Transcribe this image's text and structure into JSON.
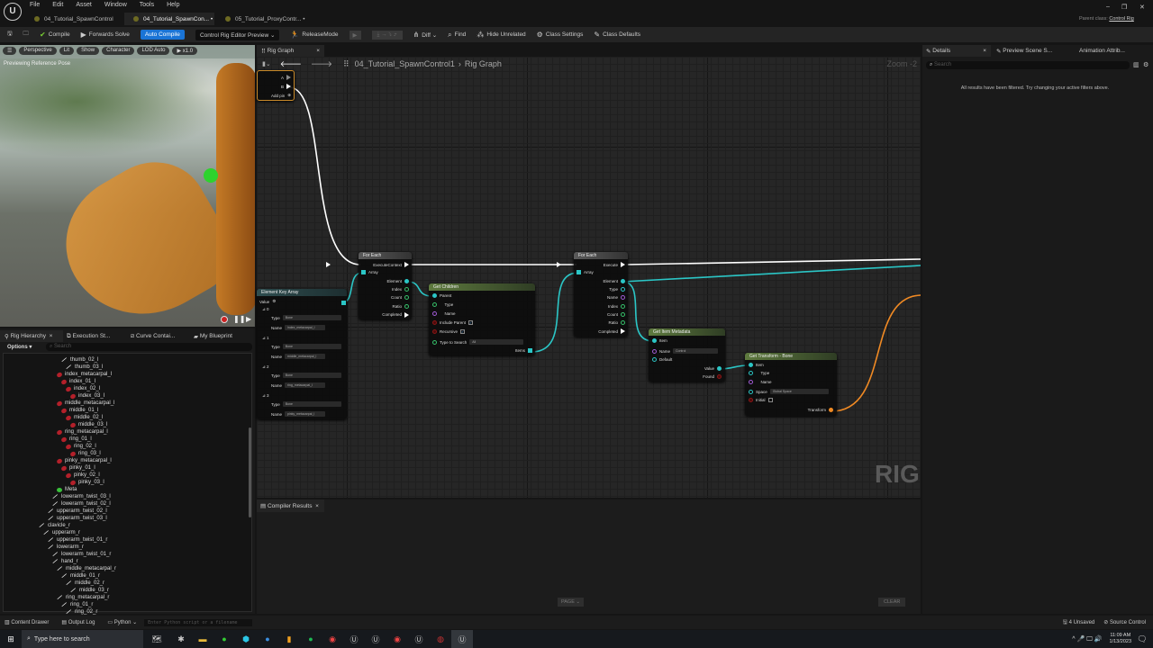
{
  "menu": [
    "File",
    "Edit",
    "Asset",
    "Window",
    "Tools",
    "Help"
  ],
  "doc_tabs": [
    {
      "label": "04_Tutorial_SpawnControl"
    },
    {
      "label": "04_Tutorial_SpawnCon... •",
      "close": "×"
    },
    {
      "label": "05_Tutorial_ProxyContr... •"
    }
  ],
  "window": {
    "parent_class_label": "Parent class:",
    "parent_class": "Control Rig",
    "minimize": "–",
    "restore": "❐",
    "close": "✕"
  },
  "toolbar": {
    "compile": "Compile",
    "forwards_solve": "Forwards Solve",
    "auto_compile": "Auto Compile",
    "preview": "Control Rig Editor Preview ⌄",
    "release_mode": "ReleaseMode",
    "diff": "Diff ⌄",
    "find": "Find",
    "hide_unrelated": "Hide Unrelated",
    "class_settings": "Class Settings",
    "class_defaults": "Class Defaults"
  },
  "viewport": {
    "buttons": [
      "Perspective",
      "Lit",
      "Show",
      "Character",
      "LOD Auto",
      "▶ x1.0"
    ],
    "overlay": "Previewing Reference Pose"
  },
  "left_tabs": {
    "rig_hierarchy": "Rig Hierarchy",
    "execution_stack": "Execution St...",
    "curve_container": "Curve Contai...",
    "my_blueprint": "My Blueprint",
    "options": "Options ▾",
    "search_placeholder": "Search"
  },
  "tree": [
    {
      "label": "thumb_02_l",
      "level": 6,
      "type": "bone"
    },
    {
      "label": "thumb_03_l",
      "level": 7,
      "type": "bone"
    },
    {
      "label": "index_metacarpal_l",
      "level": 5,
      "type": "control"
    },
    {
      "label": "index_01_l",
      "level": 6,
      "type": "control"
    },
    {
      "label": "index_02_l",
      "level": 7,
      "type": "control"
    },
    {
      "label": "index_03_l",
      "level": 8,
      "type": "control"
    },
    {
      "label": "middle_metacarpal_l",
      "level": 5,
      "type": "control"
    },
    {
      "label": "middle_01_l",
      "level": 6,
      "type": "control"
    },
    {
      "label": "middle_02_l",
      "level": 7,
      "type": "control"
    },
    {
      "label": "middle_03_l",
      "level": 8,
      "type": "control"
    },
    {
      "label": "ring_metacarpal_l",
      "level": 5,
      "type": "control"
    },
    {
      "label": "ring_01_l",
      "level": 6,
      "type": "control"
    },
    {
      "label": "ring_02_l",
      "level": 7,
      "type": "control"
    },
    {
      "label": "ring_03_l",
      "level": 8,
      "type": "control"
    },
    {
      "label": "pinky_metacarpal_l",
      "level": 5,
      "type": "control"
    },
    {
      "label": "pinky_01_l",
      "level": 6,
      "type": "control"
    },
    {
      "label": "pinky_02_l",
      "level": 7,
      "type": "control"
    },
    {
      "label": "pinky_03_l",
      "level": 8,
      "type": "control"
    },
    {
      "label": "Meta",
      "level": 5,
      "type": "null"
    },
    {
      "label": "lowerarm_twist_03_l",
      "level": 4,
      "type": "bone"
    },
    {
      "label": "lowerarm_twist_02_l",
      "level": 4,
      "type": "bone"
    },
    {
      "label": "upperarm_twist_02_l",
      "level": 3,
      "type": "bone"
    },
    {
      "label": "upperarm_twist_03_l",
      "level": 3,
      "type": "bone"
    },
    {
      "label": "clavicle_r",
      "level": 1,
      "type": "bone"
    },
    {
      "label": "upperarm_r",
      "level": 2,
      "type": "bone"
    },
    {
      "label": "upperarm_twist_01_r",
      "level": 3,
      "type": "bone"
    },
    {
      "label": "lowerarm_r",
      "level": 3,
      "type": "bone"
    },
    {
      "label": "lowerarm_twist_01_r",
      "level": 4,
      "type": "bone"
    },
    {
      "label": "hand_r",
      "level": 4,
      "type": "bone"
    },
    {
      "label": "middle_metacarpal_r",
      "level": 5,
      "type": "bone"
    },
    {
      "label": "middle_01_r",
      "level": 6,
      "type": "bone"
    },
    {
      "label": "middle_02_r",
      "level": 7,
      "type": "bone"
    },
    {
      "label": "middle_03_r",
      "level": 8,
      "type": "bone"
    },
    {
      "label": "ring_metacarpal_r",
      "level": 5,
      "type": "bone"
    },
    {
      "label": "ring_01_r",
      "level": 6,
      "type": "bone"
    },
    {
      "label": "ring_02_r",
      "level": 7,
      "type": "bone"
    }
  ],
  "graph": {
    "tab": "Rig Graph",
    "breadcrumb_asset": "04_Tutorial_SpawnControl1",
    "breadcrumb_sep": "›",
    "breadcrumb_graph": "Rig Graph",
    "zoom": "Zoom -2",
    "watermark": "RIG",
    "seq_node": {
      "pin_a": "A",
      "pin_b": "B",
      "add_pin": "Add pin"
    },
    "for_each_1": {
      "title": "For Each",
      "pins": [
        "ExecuteContext",
        "Array",
        "Element",
        "Index",
        "Count",
        "Ratio",
        "Completed"
      ]
    },
    "key_array": {
      "title": "Element Key Array",
      "value": "Value",
      "type_label": "Type",
      "name_label": "Name",
      "items": [
        {
          "idx": "0",
          "type": "Bone",
          "name": "index_metacarpal_l"
        },
        {
          "idx": "1",
          "type": "Bone",
          "name": "middle_metacarpal_l"
        },
        {
          "idx": "2",
          "type": "Bone",
          "name": "ring_metacarpal_l"
        },
        {
          "idx": "3",
          "type": "Bone",
          "name": "pinky_metacarpal_l"
        }
      ]
    },
    "get_children": {
      "title": "Get Children",
      "parent": "Parent",
      "type": "Type",
      "name": "Name",
      "include_parent": "Include Parent",
      "recursive": "Recursive",
      "type_to_search": "Type to Search",
      "type_to_search_value": "All",
      "items": "Items",
      "check": "✓"
    },
    "for_each_2": {
      "title": "For Each",
      "pins": [
        "Execute",
        "Array",
        "Element",
        "Type",
        "Name",
        "Index",
        "Count",
        "Ratio",
        "Completed"
      ]
    },
    "get_metadata": {
      "title": "Get Item Metadata",
      "item": "Item",
      "name": "Name",
      "name_value": "Control",
      "default": "Default",
      "value": "Value",
      "found": "Found"
    },
    "get_transform": {
      "title": "Get Transform - Bone",
      "item": "Item",
      "type": "Type",
      "name": "Name",
      "space": "Space",
      "space_value": "Global Space",
      "initial": "Initial",
      "transform": "Transform"
    }
  },
  "compiler": {
    "tab": "Compiler Results",
    "page": "PAGE ⌄",
    "clear": "CLEAR"
  },
  "details": {
    "tab": "Details",
    "tab2": "Preview Scene S...",
    "tab3": "Animation Attrib...",
    "search_placeholder": "Search",
    "message": "All results have been filtered. Try changing your active filters above."
  },
  "status": {
    "content_drawer": "Content Drawer",
    "output_log": "Output Log",
    "python": "Python ⌄",
    "python_placeholder": "Enter Python script or a filename",
    "unsaved": "4 Unsaved",
    "source_control": "Source Control"
  },
  "taskbar": {
    "search": "Type here to search",
    "time": "11:09 AM",
    "date": "1/13/2023"
  }
}
